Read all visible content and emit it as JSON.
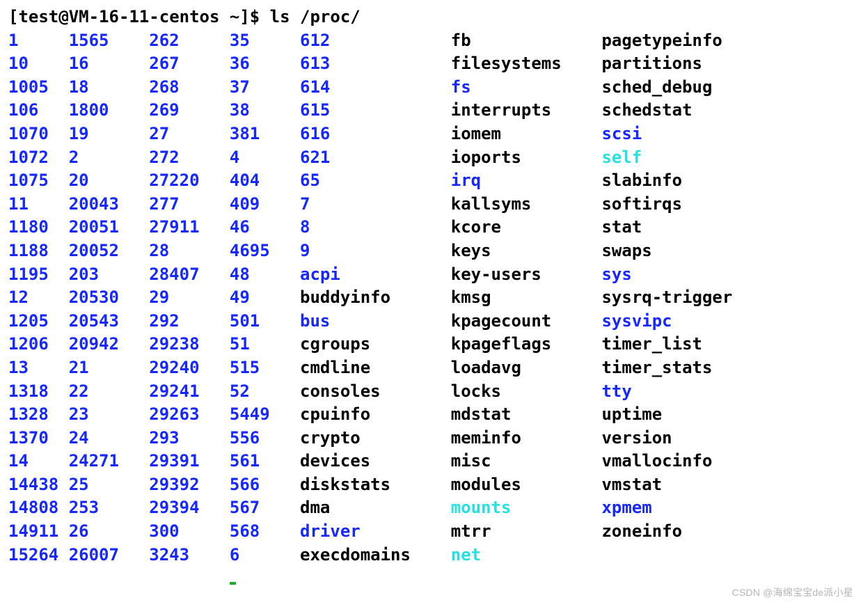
{
  "prompt": "[test@VM-16-11-centos ~]$ ls /proc/",
  "watermark": "CSDN @海绵宝宝de派小星",
  "cols": [
    [
      {
        "text": "1",
        "type": "dir"
      },
      {
        "text": "10",
        "type": "dir"
      },
      {
        "text": "1005",
        "type": "dir"
      },
      {
        "text": "106",
        "type": "dir"
      },
      {
        "text": "1070",
        "type": "dir"
      },
      {
        "text": "1072",
        "type": "dir"
      },
      {
        "text": "1075",
        "type": "dir"
      },
      {
        "text": "11",
        "type": "dir"
      },
      {
        "text": "1180",
        "type": "dir"
      },
      {
        "text": "1188",
        "type": "dir"
      },
      {
        "text": "1195",
        "type": "dir"
      },
      {
        "text": "12",
        "type": "dir"
      },
      {
        "text": "1205",
        "type": "dir"
      },
      {
        "text": "1206",
        "type": "dir"
      },
      {
        "text": "13",
        "type": "dir"
      },
      {
        "text": "1318",
        "type": "dir"
      },
      {
        "text": "1328",
        "type": "dir"
      },
      {
        "text": "1370",
        "type": "dir"
      },
      {
        "text": "14",
        "type": "dir"
      },
      {
        "text": "14438",
        "type": "dir"
      },
      {
        "text": "14808",
        "type": "dir"
      },
      {
        "text": "14911",
        "type": "dir"
      },
      {
        "text": "15264",
        "type": "dir"
      }
    ],
    [
      {
        "text": "1565",
        "type": "dir"
      },
      {
        "text": "16",
        "type": "dir"
      },
      {
        "text": "18",
        "type": "dir"
      },
      {
        "text": "1800",
        "type": "dir"
      },
      {
        "text": "19",
        "type": "dir"
      },
      {
        "text": "2",
        "type": "dir"
      },
      {
        "text": "20",
        "type": "dir"
      },
      {
        "text": "20043",
        "type": "dir"
      },
      {
        "text": "20051",
        "type": "dir"
      },
      {
        "text": "20052",
        "type": "dir"
      },
      {
        "text": "203",
        "type": "dir"
      },
      {
        "text": "20530",
        "type": "dir"
      },
      {
        "text": "20543",
        "type": "dir"
      },
      {
        "text": "20942",
        "type": "dir"
      },
      {
        "text": "21",
        "type": "dir"
      },
      {
        "text": "22",
        "type": "dir"
      },
      {
        "text": "23",
        "type": "dir"
      },
      {
        "text": "24",
        "type": "dir"
      },
      {
        "text": "24271",
        "type": "dir"
      },
      {
        "text": "25",
        "type": "dir"
      },
      {
        "text": "253",
        "type": "dir"
      },
      {
        "text": "26",
        "type": "dir"
      },
      {
        "text": "26007",
        "type": "dir"
      }
    ],
    [
      {
        "text": "262",
        "type": "dir"
      },
      {
        "text": "267",
        "type": "dir"
      },
      {
        "text": "268",
        "type": "dir"
      },
      {
        "text": "269",
        "type": "dir"
      },
      {
        "text": "27",
        "type": "dir"
      },
      {
        "text": "272",
        "type": "dir"
      },
      {
        "text": "27220",
        "type": "dir"
      },
      {
        "text": "277",
        "type": "dir"
      },
      {
        "text": "27911",
        "type": "dir"
      },
      {
        "text": "28",
        "type": "dir"
      },
      {
        "text": "28407",
        "type": "dir"
      },
      {
        "text": "29",
        "type": "dir"
      },
      {
        "text": "292",
        "type": "dir"
      },
      {
        "text": "29238",
        "type": "dir"
      },
      {
        "text": "29240",
        "type": "dir"
      },
      {
        "text": "29241",
        "type": "dir"
      },
      {
        "text": "29263",
        "type": "dir"
      },
      {
        "text": "293",
        "type": "dir"
      },
      {
        "text": "29391",
        "type": "dir"
      },
      {
        "text": "29392",
        "type": "dir"
      },
      {
        "text": "29394",
        "type": "dir"
      },
      {
        "text": "300",
        "type": "dir"
      },
      {
        "text": "3243",
        "type": "dir"
      }
    ],
    [
      {
        "text": "35",
        "type": "dir"
      },
      {
        "text": "36",
        "type": "dir"
      },
      {
        "text": "37",
        "type": "dir"
      },
      {
        "text": "38",
        "type": "dir"
      },
      {
        "text": "381",
        "type": "dir"
      },
      {
        "text": "4",
        "type": "dir"
      },
      {
        "text": "404",
        "type": "dir"
      },
      {
        "text": "409",
        "type": "dir"
      },
      {
        "text": "46",
        "type": "dir"
      },
      {
        "text": "4695",
        "type": "dir"
      },
      {
        "text": "48",
        "type": "dir"
      },
      {
        "text": "49",
        "type": "dir"
      },
      {
        "text": "501",
        "type": "dir"
      },
      {
        "text": "51",
        "type": "dir"
      },
      {
        "text": "515",
        "type": "dir"
      },
      {
        "text": "52",
        "type": "dir"
      },
      {
        "text": "5449",
        "type": "dir"
      },
      {
        "text": "556",
        "type": "dir"
      },
      {
        "text": "561",
        "type": "dir"
      },
      {
        "text": "566",
        "type": "dir"
      },
      {
        "text": "567",
        "type": "dir"
      },
      {
        "text": "568",
        "type": "dir"
      },
      {
        "text": "6",
        "type": "dir"
      }
    ],
    [
      {
        "text": "612",
        "type": "dir"
      },
      {
        "text": "613",
        "type": "dir"
      },
      {
        "text": "614",
        "type": "dir"
      },
      {
        "text": "615",
        "type": "dir"
      },
      {
        "text": "616",
        "type": "dir"
      },
      {
        "text": "621",
        "type": "dir"
      },
      {
        "text": "65",
        "type": "dir"
      },
      {
        "text": "7",
        "type": "dir"
      },
      {
        "text": "8",
        "type": "dir"
      },
      {
        "text": "9",
        "type": "dir"
      },
      {
        "text": "acpi",
        "type": "dir"
      },
      {
        "text": "buddyinfo",
        "type": "file"
      },
      {
        "text": "bus",
        "type": "dir"
      },
      {
        "text": "cgroups",
        "type": "file"
      },
      {
        "text": "cmdline",
        "type": "file"
      },
      {
        "text": "consoles",
        "type": "file"
      },
      {
        "text": "cpuinfo",
        "type": "file"
      },
      {
        "text": "crypto",
        "type": "file"
      },
      {
        "text": "devices",
        "type": "file"
      },
      {
        "text": "diskstats",
        "type": "file"
      },
      {
        "text": "dma",
        "type": "file"
      },
      {
        "text": "driver",
        "type": "dir"
      },
      {
        "text": "execdomains",
        "type": "file"
      }
    ],
    [
      {
        "text": "fb",
        "type": "file"
      },
      {
        "text": "filesystems",
        "type": "file"
      },
      {
        "text": "fs",
        "type": "dir"
      },
      {
        "text": "interrupts",
        "type": "file"
      },
      {
        "text": "iomem",
        "type": "file"
      },
      {
        "text": "ioports",
        "type": "file"
      },
      {
        "text": "irq",
        "type": "dir"
      },
      {
        "text": "kallsyms",
        "type": "file"
      },
      {
        "text": "kcore",
        "type": "file"
      },
      {
        "text": "keys",
        "type": "file"
      },
      {
        "text": "key-users",
        "type": "file"
      },
      {
        "text": "kmsg",
        "type": "file"
      },
      {
        "text": "kpagecount",
        "type": "file"
      },
      {
        "text": "kpageflags",
        "type": "file"
      },
      {
        "text": "loadavg",
        "type": "file"
      },
      {
        "text": "locks",
        "type": "file"
      },
      {
        "text": "mdstat",
        "type": "file"
      },
      {
        "text": "meminfo",
        "type": "file"
      },
      {
        "text": "misc",
        "type": "file"
      },
      {
        "text": "modules",
        "type": "file"
      },
      {
        "text": "mounts",
        "type": "link"
      },
      {
        "text": "mtrr",
        "type": "file"
      },
      {
        "text": "net",
        "type": "link"
      }
    ],
    [
      {
        "text": "pagetypeinfo",
        "type": "file"
      },
      {
        "text": "partitions",
        "type": "file"
      },
      {
        "text": "sched_debug",
        "type": "file"
      },
      {
        "text": "schedstat",
        "type": "file"
      },
      {
        "text": "scsi",
        "type": "dir"
      },
      {
        "text": "self",
        "type": "link"
      },
      {
        "text": "slabinfo",
        "type": "file"
      },
      {
        "text": "softirqs",
        "type": "file"
      },
      {
        "text": "stat",
        "type": "file"
      },
      {
        "text": "swaps",
        "type": "file"
      },
      {
        "text": "sys",
        "type": "dir"
      },
      {
        "text": "sysrq-trigger",
        "type": "file"
      },
      {
        "text": "sysvipc",
        "type": "dir"
      },
      {
        "text": "timer_list",
        "type": "file"
      },
      {
        "text": "timer_stats",
        "type": "file"
      },
      {
        "text": "tty",
        "type": "dir"
      },
      {
        "text": "uptime",
        "type": "file"
      },
      {
        "text": "version",
        "type": "file"
      },
      {
        "text": "vmallocinfo",
        "type": "file"
      },
      {
        "text": "vmstat",
        "type": "file"
      },
      {
        "text": "xpmem",
        "type": "dir"
      },
      {
        "text": "zoneinfo",
        "type": "file"
      },
      {
        "text": "",
        "type": "file"
      }
    ]
  ]
}
